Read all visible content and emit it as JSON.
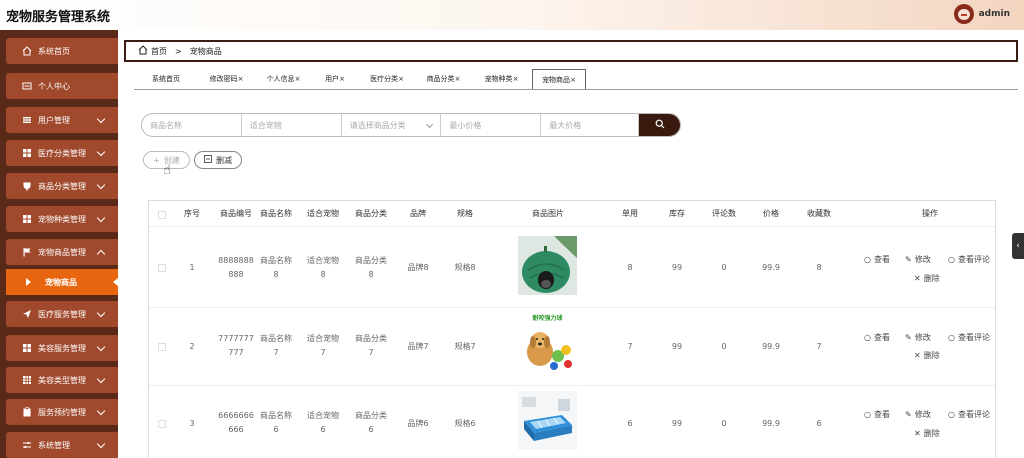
{
  "header": {
    "title": "宠物服务管理系统",
    "username": "admin"
  },
  "sidebar": {
    "items": [
      {
        "label": "系统首页",
        "icon": "home-icon",
        "has_children": false
      },
      {
        "label": "个人中心",
        "icon": "id-card-icon",
        "has_children": false
      },
      {
        "label": "用户管理",
        "icon": "list-icon",
        "has_children": true
      },
      {
        "label": "医疗分类管理",
        "icon": "grid-icon",
        "has_children": true
      },
      {
        "label": "商品分类管理",
        "icon": "cup-icon",
        "has_children": true
      },
      {
        "label": "宠物种类管理",
        "icon": "grid-icon",
        "has_children": true
      },
      {
        "label": "宠物商品管理",
        "icon": "flag-icon",
        "has_children": true
      },
      {
        "label": "医疗服务管理",
        "icon": "send-icon",
        "has_children": true
      },
      {
        "label": "美容服务管理",
        "icon": "grid-icon",
        "has_children": true
      },
      {
        "label": "美容类型管理",
        "icon": "table-icon",
        "has_children": true
      },
      {
        "label": "服务预约管理",
        "icon": "clipboard-icon",
        "has_children": true
      },
      {
        "label": "系统管理",
        "icon": "sliders-icon",
        "has_children": true
      }
    ],
    "active_sub": "宠物商品"
  },
  "breadcrumb": {
    "home": "首页",
    "separator": ">",
    "current": "宠物商品"
  },
  "tabs": [
    {
      "label": "系统首页",
      "closable": false
    },
    {
      "label": "修改密码",
      "closable": true
    },
    {
      "label": "个人信息",
      "closable": true
    },
    {
      "label": "用户",
      "closable": true
    },
    {
      "label": "医疗分类",
      "closable": true
    },
    {
      "label": "商品分类",
      "closable": true
    },
    {
      "label": "宠物种类",
      "closable": true
    },
    {
      "label": "宠物商品",
      "closable": true,
      "active": true
    }
  ],
  "tab_close_glyph": "×",
  "filters": {
    "name_placeholder": "商品名称",
    "pet_placeholder": "适合宠物",
    "category_placeholder": "请选择商品分类",
    "min_price_placeholder": "最小价格",
    "max_price_placeholder": "最大价格"
  },
  "buttons": {
    "add": "创建",
    "delete": "删减"
  },
  "table": {
    "headers": [
      "序号",
      "商品编号",
      "商品名称",
      "适合宠物",
      "商品分类",
      "品牌",
      "规格",
      "商品图片",
      "单用",
      "库存",
      "评论数",
      "价格",
      "收藏数",
      "操作"
    ],
    "rows": [
      {
        "index": "1",
        "code": "8888888888",
        "name": "商品名称8",
        "pet": "适合宠物8",
        "category": "商品分类8",
        "brand": "品牌8",
        "spec": "规格8",
        "unit": "8",
        "stock": "99",
        "comments": "0",
        "price": "99.9",
        "favorites": "8",
        "image": "pet-house-image"
      },
      {
        "index": "2",
        "code": "7777777777",
        "name": "商品名称7",
        "pet": "适合宠物7",
        "category": "商品分类7",
        "brand": "品牌7",
        "spec": "规格7",
        "unit": "7",
        "stock": "99",
        "comments": "0",
        "price": "99.9",
        "favorites": "7",
        "image": "dog-toy-image",
        "image_caption": "耐咬强力球"
      },
      {
        "index": "3",
        "code": "6666666666",
        "name": "商品名称6",
        "pet": "适合宠物6",
        "category": "商品分类6",
        "brand": "品牌6",
        "spec": "规格6",
        "unit": "6",
        "stock": "99",
        "comments": "0",
        "price": "99.9",
        "favorites": "6",
        "image": "pet-bath-image"
      }
    ],
    "actions": {
      "view": "查看",
      "edit": "修改",
      "view_comments": "查看评论",
      "delete": "删除"
    }
  },
  "colors": {
    "sidebar_bg": "#5a2a18",
    "nav_item": "#a0492c",
    "nav_active": "#e8660f",
    "search_button": "#3a1a0e"
  }
}
